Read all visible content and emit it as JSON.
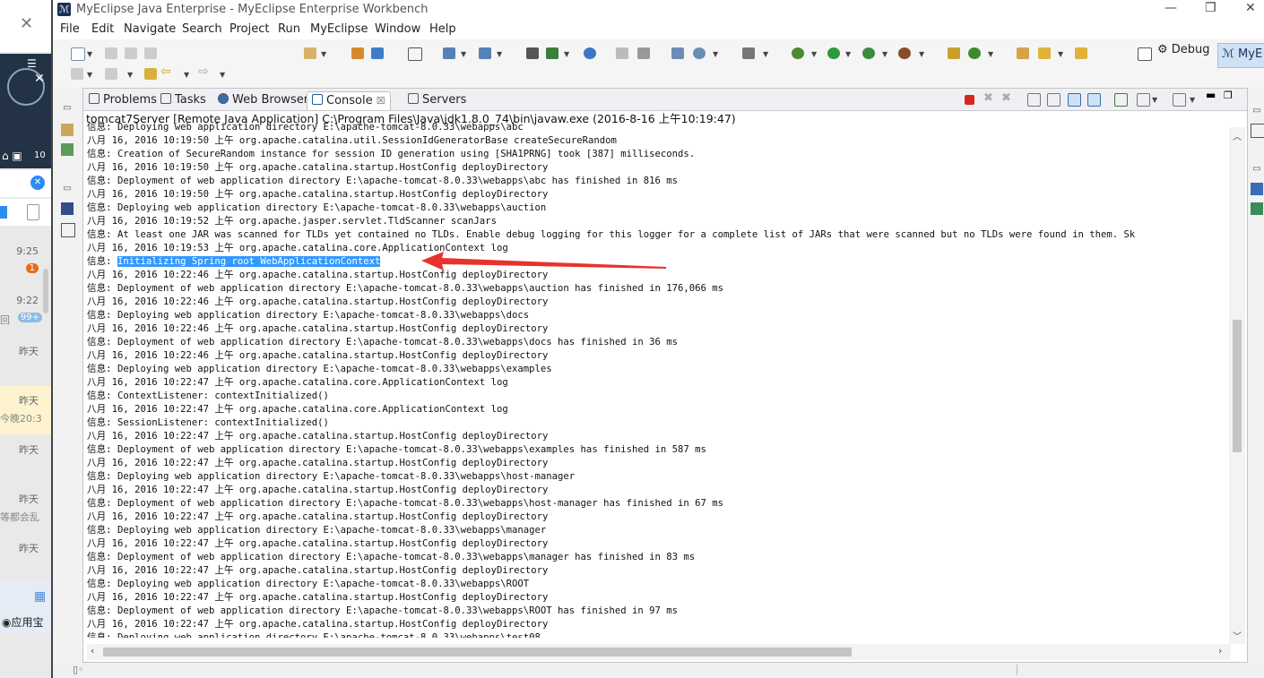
{
  "chat": {
    "badge_count": "10",
    "items": [
      {
        "time": "9:25",
        "badge": "1",
        "sub": ""
      },
      {
        "time": "9:22",
        "badge": "99+",
        "sub": "回"
      },
      {
        "time": "昨天",
        "badge": "",
        "sub": ""
      },
      {
        "time": "昨天",
        "badge": "",
        "sub": "今晚20:3"
      },
      {
        "time": "昨天",
        "badge": "",
        "sub": ""
      },
      {
        "time": "昨天",
        "badge": "",
        "sub": "等都会乱"
      },
      {
        "time": "昨天",
        "badge": "",
        "sub": ""
      }
    ],
    "app_label": "应用宝"
  },
  "window": {
    "title": "MyEclipse Java Enterprise - MyEclipse Enterprise Workbench",
    "menu": [
      "File",
      "Edit",
      "Navigate",
      "Search",
      "Project",
      "Run",
      "MyEclipse",
      "Window",
      "Help"
    ],
    "perspectives": {
      "debug": "Debug",
      "current": "MyE"
    }
  },
  "tabs": [
    {
      "label": "Problems"
    },
    {
      "label": "Tasks"
    },
    {
      "label": "Web Browser"
    },
    {
      "label": "Console",
      "close": "☒"
    },
    {
      "label": "Servers"
    }
  ],
  "console": {
    "header": "tomcat7Server [Remote Java Application] C:\\Program Files\\Java\\jdk1.8.0_74\\bin\\javaw.exe (2016-8-16 上午10:19:47)",
    "lines": [
      "信息: Deploying web application directory E:\\apache-tomcat-8.0.33\\webapps\\abc",
      "八月 16, 2016 10:19:50 上午 org.apache.catalina.util.SessionIdGeneratorBase createSecureRandom",
      "信息: Creation of SecureRandom instance for session ID generation using [SHA1PRNG] took [387] milliseconds.",
      "八月 16, 2016 10:19:50 上午 org.apache.catalina.startup.HostConfig deployDirectory",
      "信息: Deployment of web application directory E:\\apache-tomcat-8.0.33\\webapps\\abc has finished in 816 ms",
      "八月 16, 2016 10:19:50 上午 org.apache.catalina.startup.HostConfig deployDirectory",
      "信息: Deploying web application directory E:\\apache-tomcat-8.0.33\\webapps\\auction",
      "八月 16, 2016 10:19:52 上午 org.apache.jasper.servlet.TldScanner scanJars",
      "信息: At least one JAR was scanned for TLDs yet contained no TLDs. Enable debug logging for this logger for a complete list of JARs that were scanned but no TLDs were found in them. Sk",
      "八月 16, 2016 10:19:53 上午 org.apache.catalina.core.ApplicationContext log",
      "信息: ",
      "八月 16, 2016 10:22:46 上午 org.apache.catalina.startup.HostConfig deployDirectory",
      "信息: Deployment of web application directory E:\\apache-tomcat-8.0.33\\webapps\\auction has finished in 176,066 ms",
      "八月 16, 2016 10:22:46 上午 org.apache.catalina.startup.HostConfig deployDirectory",
      "信息: Deploying web application directory E:\\apache-tomcat-8.0.33\\webapps\\docs",
      "八月 16, 2016 10:22:46 上午 org.apache.catalina.startup.HostConfig deployDirectory",
      "信息: Deployment of web application directory E:\\apache-tomcat-8.0.33\\webapps\\docs has finished in 36 ms",
      "八月 16, 2016 10:22:46 上午 org.apache.catalina.startup.HostConfig deployDirectory",
      "信息: Deploying web application directory E:\\apache-tomcat-8.0.33\\webapps\\examples",
      "八月 16, 2016 10:22:47 上午 org.apache.catalina.core.ApplicationContext log",
      "信息: ContextListener: contextInitialized()",
      "八月 16, 2016 10:22:47 上午 org.apache.catalina.core.ApplicationContext log",
      "信息: SessionListener: contextInitialized()",
      "八月 16, 2016 10:22:47 上午 org.apache.catalina.startup.HostConfig deployDirectory",
      "信息: Deployment of web application directory E:\\apache-tomcat-8.0.33\\webapps\\examples has finished in 587 ms",
      "八月 16, 2016 10:22:47 上午 org.apache.catalina.startup.HostConfig deployDirectory",
      "信息: Deploying web application directory E:\\apache-tomcat-8.0.33\\webapps\\host-manager",
      "八月 16, 2016 10:22:47 上午 org.apache.catalina.startup.HostConfig deployDirectory",
      "信息: Deployment of web application directory E:\\apache-tomcat-8.0.33\\webapps\\host-manager has finished in 67 ms",
      "八月 16, 2016 10:22:47 上午 org.apache.catalina.startup.HostConfig deployDirectory",
      "信息: Deploying web application directory E:\\apache-tomcat-8.0.33\\webapps\\manager",
      "八月 16, 2016 10:22:47 上午 org.apache.catalina.startup.HostConfig deployDirectory",
      "信息: Deployment of web application directory E:\\apache-tomcat-8.0.33\\webapps\\manager has finished in 83 ms",
      "八月 16, 2016 10:22:47 上午 org.apache.catalina.startup.HostConfig deployDirectory",
      "信息: Deploying web application directory E:\\apache-tomcat-8.0.33\\webapps\\ROOT",
      "八月 16, 2016 10:22:47 上午 org.apache.catalina.startup.HostConfig deployDirectory",
      "信息: Deployment of web application directory E:\\apache-tomcat-8.0.33\\webapps\\ROOT has finished in 97 ms",
      "八月 16, 2016 10:22:47 上午 org.apache.catalina.startup.HostConfig deployDirectory",
      "信息: Deploying web application directory E:\\apache-tomcat-8.0.33\\webapps\\test08"
    ],
    "highlight_line_index": 10,
    "highlight_text": "Initializing Spring root WebApplicationContext"
  },
  "colors": {
    "selection": "#3399ff",
    "arrow": "#e8322c",
    "terminate": "#d9261c"
  }
}
